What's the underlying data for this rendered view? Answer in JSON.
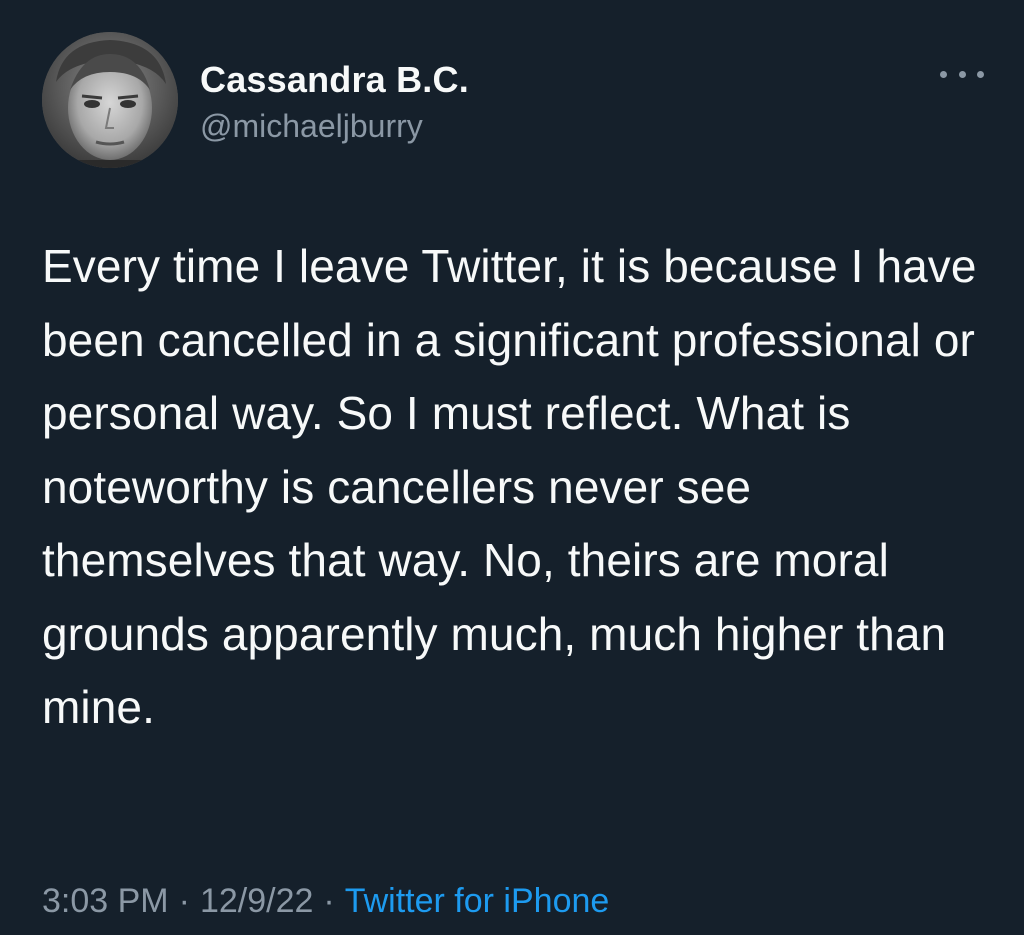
{
  "author": {
    "display_name": "Cassandra B.C.",
    "handle": "@michaeljburry",
    "avatar_icon": "avatar-photo"
  },
  "more_icon": "more-horizontal-icon",
  "tweet": {
    "text": "Every time I leave Twitter, it is because I have been cancelled in a significant professional or personal way. So I must reflect. What is noteworthy is cancellers never see themselves that way. No, theirs are moral grounds apparently much, much higher than mine."
  },
  "meta": {
    "time": "3:03 PM",
    "date": "12/9/22",
    "separator": "·",
    "source": "Twitter for iPhone"
  },
  "colors": {
    "background": "#15202b",
    "primary_text": "#f7f9f9",
    "secondary_text": "#8b98a5",
    "accent": "#1d9bf0"
  }
}
